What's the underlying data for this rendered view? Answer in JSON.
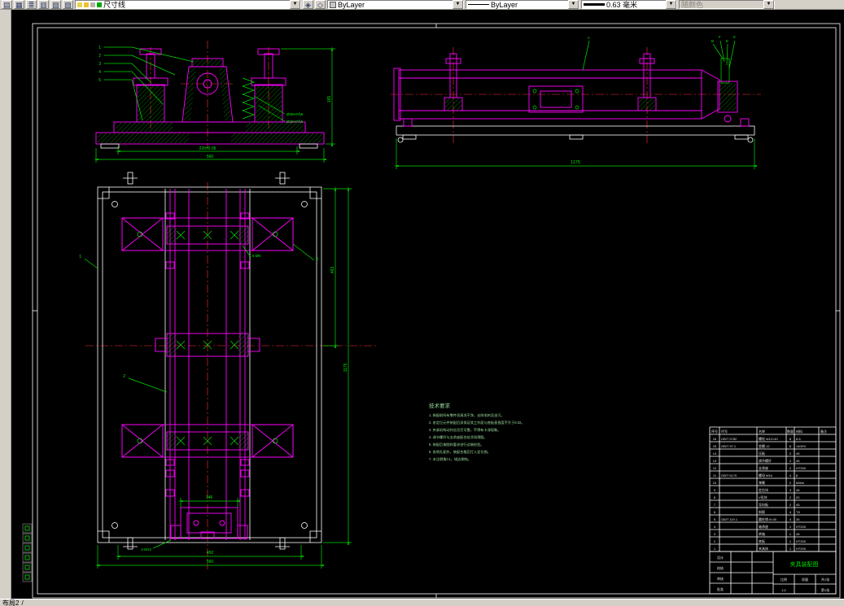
{
  "toolbar": {
    "icons_left": [
      {
        "name": "new-icon",
        "glyph": "▤"
      },
      {
        "name": "open-icon",
        "glyph": "▦"
      },
      {
        "name": "layer-manager-icon",
        "glyph": "≣"
      },
      {
        "name": "layer-states-icon",
        "glyph": "▥"
      },
      {
        "name": "layer-on-off-icon",
        "glyph": "▧"
      },
      {
        "name": "layer-freeze-icon",
        "glyph": "▨"
      }
    ],
    "icons_mid": [
      {
        "name": "make-layer-current-icon",
        "glyph": "◈"
      },
      {
        "name": "layer-previous-icon",
        "glyph": "◇"
      }
    ],
    "layer": {
      "value": "尺寸线"
    },
    "color": {
      "value": "ByLayer"
    },
    "linetype": {
      "value": "ByLayer"
    },
    "lineweight": {
      "value": "0.63 毫米"
    },
    "plot_style": {
      "value": "随颜色"
    },
    "dropdown_arrow": "▼"
  },
  "statusbar": {
    "layout_tab": "布局2",
    "separator": "/"
  },
  "colors": {
    "dimension": "#00ee00",
    "part_outline": "#ff00ff",
    "centerline": "#ff3333",
    "notes": "#9fdf9f",
    "sheet": "#ffffff",
    "canvas": "#000000",
    "toolbar": "#d4d0c8"
  },
  "drawing": {
    "front_view": {
      "balloons": [
        "1",
        "2",
        "3",
        "4",
        "5"
      ],
      "dims": {
        "width_inner": "220±0.05",
        "width_overall": "560",
        "height": "165"
      },
      "fits": [
        "Ø30H7/k6",
        "Ø25H7/k6"
      ]
    },
    "side_view": {
      "labels": [
        "n",
        "B",
        "F",
        "E",
        "K"
      ],
      "dims": {
        "length": "1175"
      }
    },
    "plan_view": {
      "balloons": [
        "1",
        "2",
        "3"
      ],
      "callouts": {
        "holes": "6-Ø9",
        "bolts": "4-M12"
      },
      "dims": {
        "slot": "146",
        "inner": "450",
        "width": "560",
        "upper": "463",
        "height": "1175"
      }
    },
    "notes": {
      "title": "技术要求",
      "lines": [
        "1. 装配前所有零件须清洗干净，去除毛刺及油污。",
        "2. 各定位元件装配后须保证其工作面与底板垂直度不大于0.02。",
        "3. 夹紧机构动作应灵活可靠，不得有卡滞现象。",
        "4. 调节螺杆与支承座配合处涂润滑脂。",
        "5. 装配后按图样要求进行试装检验。",
        "6. 各销孔配作，装配合格后打入定位销。",
        "7. 未注倒角C1，锐边倒钝。"
      ]
    },
    "bom": {
      "header": [
        "序号",
        "代号",
        "名称",
        "数量",
        "材料",
        "备注"
      ],
      "rows": [
        [
          "16",
          "GB/T 5782",
          "螺栓 M12×40",
          "8",
          "8.8",
          ""
        ],
        [
          "15",
          "GB/T 97.1",
          "垫圈 12",
          "8",
          "140HV",
          ""
        ],
        [
          "14",
          "",
          "压板",
          "2",
          "45",
          ""
        ],
        [
          "13",
          "",
          "调节螺杆",
          "2",
          "45",
          ""
        ],
        [
          "12",
          "",
          "支承座",
          "2",
          "HT200",
          ""
        ],
        [
          "11",
          "GB/T 6170",
          "螺母 M16",
          "4",
          "8",
          ""
        ],
        [
          "10",
          "",
          "弹簧",
          "2",
          "65Mn",
          ""
        ],
        [
          "9",
          "",
          "定位块",
          "3",
          "45",
          ""
        ],
        [
          "8",
          "",
          "V形块",
          "2",
          "20",
          ""
        ],
        [
          "7",
          "",
          "导向板",
          "2",
          "45",
          ""
        ],
        [
          "6",
          "",
          "斜楔",
          "4",
          "T8",
          ""
        ],
        [
          "5",
          "GB/T 119.1",
          "圆柱销 8×30",
          "4",
          "35",
          ""
        ],
        [
          "4",
          "",
          "轴承座",
          "1",
          "HT200",
          ""
        ],
        [
          "3",
          "",
          "转轴",
          "1",
          "45",
          ""
        ],
        [
          "2",
          "",
          "底板",
          "1",
          "HT200",
          ""
        ],
        [
          "1",
          "",
          "夹具体",
          "1",
          "HT200",
          ""
        ]
      ]
    },
    "title_block": {
      "roles": [
        "设计",
        "校核",
        "审核",
        "批准"
      ],
      "title": "夹具装配图",
      "scale_label": "比例",
      "scale": "1:2",
      "mass_label": "质量",
      "sheet": "共1张",
      "sheet2": "第1张"
    }
  }
}
